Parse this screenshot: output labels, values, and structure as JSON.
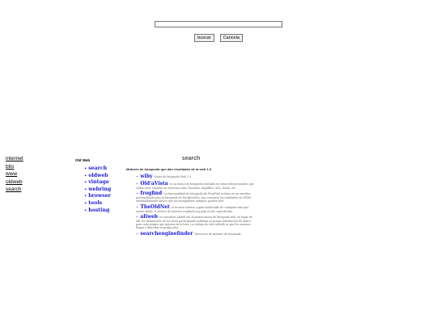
{
  "search": {
    "value": "",
    "placeholder": ""
  },
  "buttons": {
    "search": "buscar",
    "cancel": "Cancela"
  },
  "left_links": [
    "internet",
    "bbs",
    "www",
    "oldweb",
    "search"
  ],
  "old_web": {
    "title": "Old Web",
    "items": [
      "search",
      "oldweb",
      "vintage",
      "webring",
      "browser",
      "tools",
      "hosting"
    ]
  },
  "main": {
    "heading": "search",
    "subtitle": "Motores de busqueda que dan resultados de la web 1.0",
    "results": [
      {
        "name": "wiby",
        "desc": "Motor de búsqueda Web 1.0"
      },
      {
        "name": "Old'aVista",
        "desc": "es un motor de búsqueda centrado en sitios web personales que solían estar alojados en servicios como Geocities, Angelfire, AOL, Xoom, etc."
      },
      {
        "name": "frogfind",
        "desc": "La funcionalidad de búsqueda de FrogFind se basa en un servidor personalizado para la búsqueda de DuckDuckGo, que convierte los resultados en HTML extremadamente básico que los navegadores antiguos pueden leer."
      },
      {
        "name": "TheOldNet",
        "desc": "el rescata nuestra copias moderadas de cualquier sitio que existió desde el archivo de Internet wayback.org para el año especificado."
      },
      {
        "name": "aliweb",
        "desc": "se considera Aliweb fue el primer motor de búsqueda web, en lugar de allí, los webmasters de los sitios participantes publican su propia información de índice para cada página que quieren en la lista. La ventaja de este método es que los usuarios llegan a describir su propio sitio."
      },
      {
        "name": "searchenginefinder",
        "desc": "Directorio de motores de busqueda"
      }
    ]
  }
}
